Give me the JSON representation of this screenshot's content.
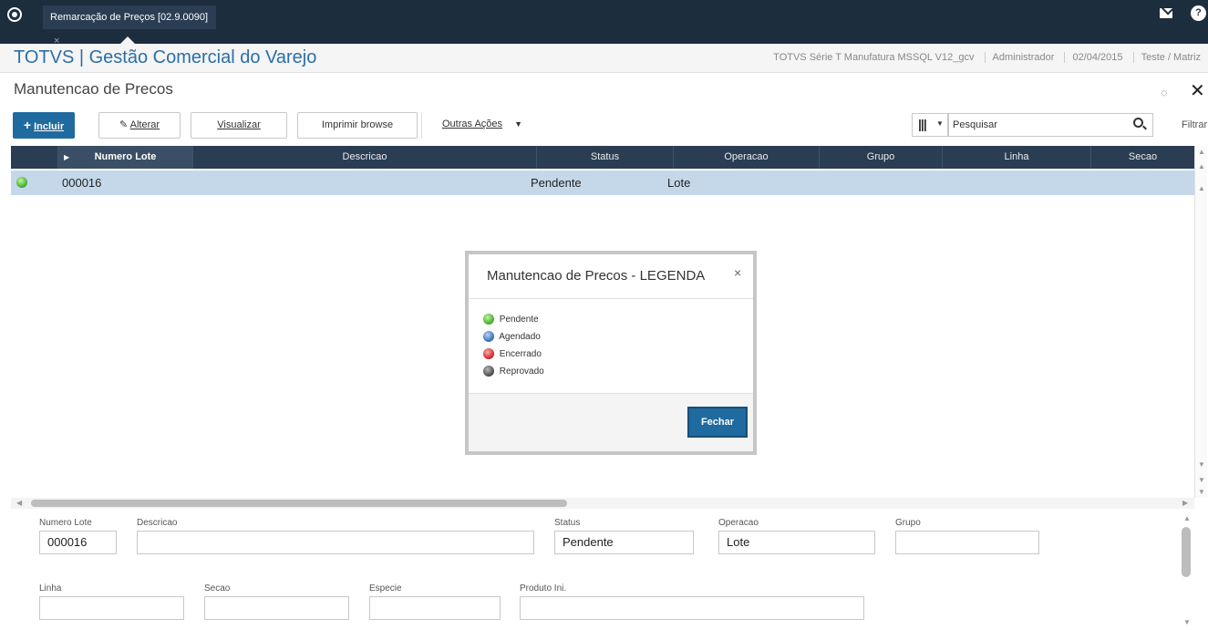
{
  "tab": {
    "title": "Remarcação de Preços [02.9.0090]",
    "close": "×"
  },
  "app": {
    "title": "TOTVS | Gestão Comercial do Varejo",
    "environment": "TOTVS Série T Manufatura MSSQL V12_gcv",
    "user": "Administrador",
    "date": "02/04/2015",
    "branch": "Teste / Matriz"
  },
  "page": {
    "title": "Manutencao de Precos",
    "close": "✕",
    "gear": "☼"
  },
  "toolbar": {
    "incluir": "Incluir",
    "alterar": "Alterar",
    "visualizar": "Visualizar",
    "imprimir": "Imprimir browse",
    "outras": "Outras Ações",
    "search_value": "Pesquisar",
    "filter": "Filtrar"
  },
  "grid": {
    "columns": [
      "Numero Lote",
      "Descricao",
      "Status",
      "Operacao",
      "Grupo",
      "Linha",
      "Secao"
    ],
    "rows": [
      {
        "numero_lote": "000016",
        "descricao": "",
        "status": "Pendente",
        "operacao": "Lote",
        "status_color": "#4bb53a"
      }
    ]
  },
  "form": {
    "labels": {
      "numero_lote": "Numero Lote",
      "descricao": "Descricao",
      "status": "Status",
      "operacao": "Operacao",
      "grupo": "Grupo",
      "linha": "Linha",
      "secao": "Secao",
      "especie": "Especie",
      "produto_ini": "Produto Ini."
    },
    "values": {
      "numero_lote": "000016",
      "descricao": "",
      "status": "Pendente",
      "operacao": "Lote",
      "grupo": "",
      "linha": "",
      "secao": "",
      "especie": "",
      "produto_ini": ""
    }
  },
  "modal": {
    "title": "Manutencao de Precos - LEGENDA",
    "close": "×",
    "legend": [
      {
        "label": "Pendente",
        "color": "#4bb53a"
      },
      {
        "label": "Agendado",
        "color": "#3e78c0"
      },
      {
        "label": "Encerrado",
        "color": "#d73030"
      },
      {
        "label": "Reprovado",
        "color": "#555555"
      }
    ],
    "button": "Fechar"
  }
}
